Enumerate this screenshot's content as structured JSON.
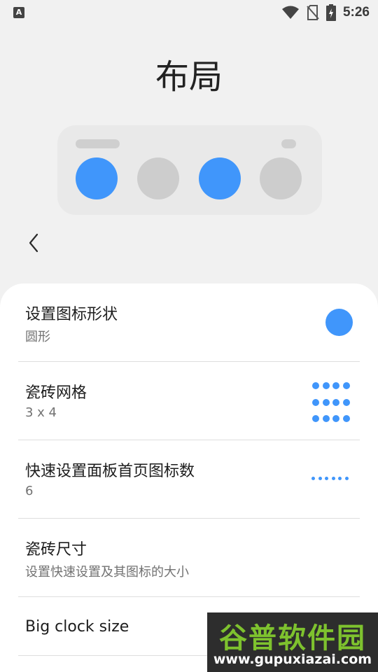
{
  "status_bar": {
    "left_icon": "A",
    "left_icon_name": "accessibility-a-icon",
    "time": "5:26",
    "icons": [
      "wifi-icon",
      "no-sim-icon",
      "battery-charging-icon"
    ]
  },
  "page": {
    "title": "布局"
  },
  "preview": {
    "circle_colors": [
      "#4096fb",
      "#cdcdcd",
      "#4096fb",
      "#cdcdcd"
    ]
  },
  "nav": {
    "back_icon": "chevron-left-icon"
  },
  "settings": [
    {
      "title": "设置图标形状",
      "subtitle": "圆形",
      "indicator": "circle-shape-icon"
    },
    {
      "title": "瓷砖网格",
      "subtitle": "3 x 4",
      "indicator": "tile-grid-icon"
    },
    {
      "title": "快速设置面板首页图标数",
      "subtitle": "6",
      "indicator": "dots-row-icon"
    },
    {
      "title": "瓷砖尺寸",
      "subtitle": "设置快速设置及其图标的大小"
    },
    {
      "title": "Big clock size"
    }
  ],
  "watermark": {
    "title": "谷普软件园",
    "url": "www.gupuxiazai.com"
  },
  "colors": {
    "accent": "#4096fb",
    "inactive": "#cdcdcd",
    "background": "#f1f1f1",
    "sheet": "#ffffff"
  }
}
